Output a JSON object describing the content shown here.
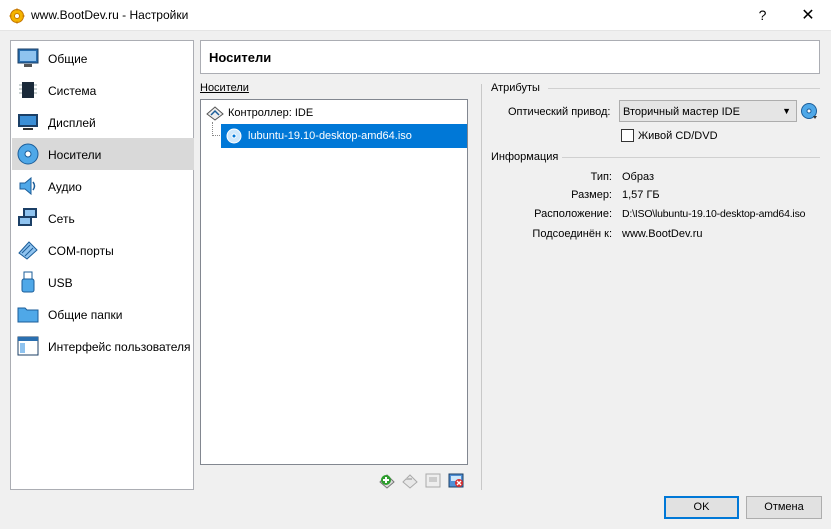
{
  "window": {
    "title": "www.BootDev.ru - Настройки",
    "help_label": "?",
    "close_label": "✕"
  },
  "sidebar": {
    "items": [
      {
        "label": "Общие",
        "icon": "general-icon"
      },
      {
        "label": "Система",
        "icon": "system-icon"
      },
      {
        "label": "Дисплей",
        "icon": "display-icon"
      },
      {
        "label": "Носители",
        "icon": "storage-icon",
        "active": true
      },
      {
        "label": "Аудио",
        "icon": "audio-icon"
      },
      {
        "label": "Сеть",
        "icon": "network-icon"
      },
      {
        "label": "COM-порты",
        "icon": "serial-ports-icon"
      },
      {
        "label": "USB",
        "icon": "usb-icon"
      },
      {
        "label": "Общие папки",
        "icon": "shared-folders-icon"
      },
      {
        "label": "Интерфейс пользователя",
        "icon": "user-interface-icon"
      }
    ]
  },
  "header": {
    "title": "Носители"
  },
  "storage": {
    "section_label": "Носители",
    "controller_label": "Контроллер: IDE",
    "disk_label": "lubuntu-19.10-desktop-amd64.iso"
  },
  "attributes": {
    "section_label": "Атрибуты",
    "optical_drive_label": "Оптический привод:",
    "optical_drive_value": "Вторичный мастер IDE",
    "live_cd_label": "Живой CD/DVD",
    "live_cd_checked": false
  },
  "info": {
    "section_label": "Информация",
    "rows": [
      {
        "key": "Тип:",
        "value": "Образ"
      },
      {
        "key": "Размер:",
        "value": "1,57 ГБ"
      },
      {
        "key": "Расположение:",
        "value": "D:\\ISO\\lubuntu-19.10-desktop-amd64.iso"
      },
      {
        "key": "Подсоединён к:",
        "value": "www.BootDev.ru"
      }
    ]
  },
  "buttons": {
    "ok": "OK",
    "cancel": "Отмена"
  },
  "colors": {
    "selection": "#0078d7",
    "active_item": "#d9d9d9"
  }
}
